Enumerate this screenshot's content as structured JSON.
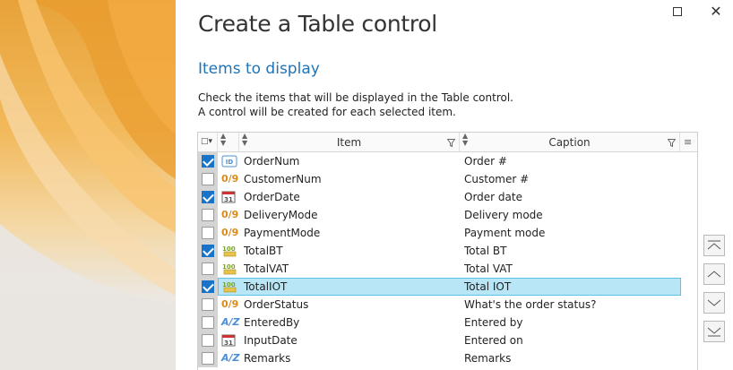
{
  "window": {
    "title": "Create a Table control",
    "maximize_icon": "maximize-icon",
    "close_label": "✕"
  },
  "section": {
    "heading": "Items to display",
    "line1": "Check the items that will be displayed in the Table control.",
    "line2": "A control will be created for each selected item."
  },
  "grid": {
    "columns": {
      "item": "Item",
      "caption": "Caption"
    },
    "rows": [
      {
        "checked": true,
        "icon": "id-icon",
        "item": "OrderNum",
        "caption": "Order #"
      },
      {
        "checked": false,
        "icon": "numeric-icon",
        "item": "CustomerNum",
        "caption": "Customer #"
      },
      {
        "checked": true,
        "icon": "calendar-icon",
        "item": "OrderDate",
        "caption": "Order date"
      },
      {
        "checked": false,
        "icon": "numeric-icon",
        "item": "DeliveryMode",
        "caption": "Delivery mode"
      },
      {
        "checked": false,
        "icon": "numeric-icon",
        "item": "PaymentMode",
        "caption": "Payment mode"
      },
      {
        "checked": true,
        "icon": "currency-icon",
        "item": "TotalBT",
        "caption": "Total BT"
      },
      {
        "checked": false,
        "icon": "currency-icon",
        "item": "TotalVAT",
        "caption": "Total VAT"
      },
      {
        "checked": true,
        "icon": "currency-icon",
        "item": "TotalIOT",
        "caption": "Total IOT",
        "selected": true
      },
      {
        "checked": false,
        "icon": "numeric-icon",
        "item": "OrderStatus",
        "caption": "What's the order status?"
      },
      {
        "checked": false,
        "icon": "text-icon",
        "item": "EnteredBy",
        "caption": "Entered by"
      },
      {
        "checked": false,
        "icon": "calendar-icon",
        "item": "InputDate",
        "caption": "Entered on"
      },
      {
        "checked": false,
        "icon": "text-icon",
        "item": "Remarks",
        "caption": "Remarks"
      }
    ],
    "icon_glyphs": {
      "numeric": "0/9",
      "text": "A/Z",
      "calendar_day": "31",
      "currency": "100"
    }
  },
  "colors": {
    "accent": "#1f73b7",
    "check": "#1874c9",
    "selection": "#b9e6f6",
    "selection_border": "#5ec3e6"
  }
}
